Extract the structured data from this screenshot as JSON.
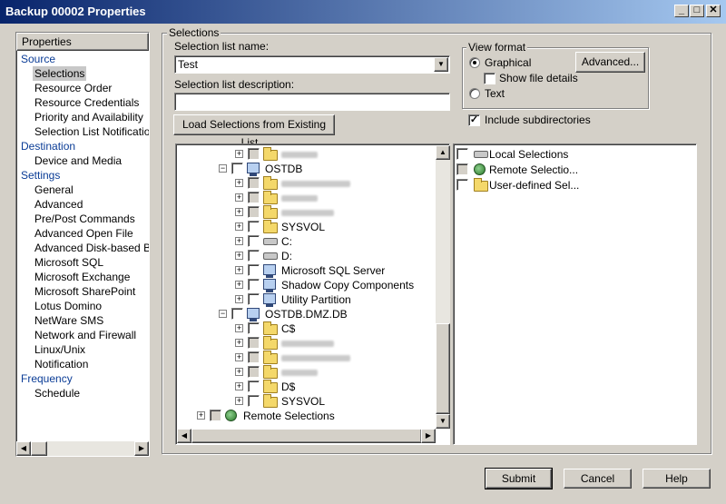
{
  "window": {
    "title": "Backup 00002 Properties",
    "controls": [
      "_",
      "□",
      "✕"
    ]
  },
  "nav": {
    "header": "Properties",
    "items": [
      {
        "label": "Source",
        "kind": "cat"
      },
      {
        "label": "Selections",
        "kind": "sel"
      },
      {
        "label": "Resource Order",
        "kind": "sub"
      },
      {
        "label": "Resource Credentials",
        "kind": "sub"
      },
      {
        "label": "Priority and Availability",
        "kind": "sub"
      },
      {
        "label": "Selection List Notification",
        "kind": "sub"
      },
      {
        "label": "Destination",
        "kind": "cat"
      },
      {
        "label": "Device and Media",
        "kind": "sub"
      },
      {
        "label": "Settings",
        "kind": "cat"
      },
      {
        "label": "General",
        "kind": "sub"
      },
      {
        "label": "Advanced",
        "kind": "sub"
      },
      {
        "label": "Pre/Post Commands",
        "kind": "sub"
      },
      {
        "label": "Advanced Open File",
        "kind": "sub"
      },
      {
        "label": "Advanced Disk-based Bac",
        "kind": "sub"
      },
      {
        "label": "Microsoft SQL",
        "kind": "sub"
      },
      {
        "label": "Microsoft Exchange",
        "kind": "sub"
      },
      {
        "label": "Microsoft SharePoint",
        "kind": "sub"
      },
      {
        "label": "Lotus Domino",
        "kind": "sub"
      },
      {
        "label": "NetWare SMS",
        "kind": "sub"
      },
      {
        "label": "Network and Firewall",
        "kind": "sub"
      },
      {
        "label": "Linux/Unix",
        "kind": "sub"
      },
      {
        "label": "Notification",
        "kind": "sub"
      },
      {
        "label": "Frequency",
        "kind": "cat"
      },
      {
        "label": "Schedule",
        "kind": "sub"
      }
    ]
  },
  "selections": {
    "group_label": "Selections",
    "list_name_label": "Selection list name:",
    "list_name_value": "Test",
    "description_label": "Selection list description:",
    "description_value": "",
    "load_button": "Load Selections from Existing List..."
  },
  "view_format": {
    "group_label": "View format",
    "graphical": "Graphical",
    "graphical_selected": true,
    "show_file_details": "Show file details",
    "text": "Text",
    "advanced_button": "Advanced...",
    "include_subdirectories": "Include subdirectories",
    "include_subdirectories_checked": true
  },
  "tree": [
    {
      "label": "",
      "icon": "folder-icon",
      "blurred": true,
      "depth": 2,
      "expander": "+"
    },
    {
      "label": "OSTDB",
      "icon": "computer-icon",
      "depth": 1,
      "expander": "-"
    },
    {
      "label": "",
      "icon": "folder-icon",
      "blurred": true,
      "depth": 2,
      "expander": "+"
    },
    {
      "label": "",
      "icon": "folder-icon",
      "blurred": true,
      "depth": 2,
      "expander": "+"
    },
    {
      "label": "",
      "icon": "folder-icon",
      "blurred": true,
      "depth": 2,
      "expander": "+"
    },
    {
      "label": "SYSVOL",
      "icon": "folder-icon",
      "depth": 2,
      "expander": "+"
    },
    {
      "label": "C:",
      "icon": "drive-icon",
      "depth": 2,
      "expander": "+"
    },
    {
      "label": "D:",
      "icon": "drive-icon",
      "depth": 2,
      "expander": "+"
    },
    {
      "label": "Microsoft SQL Server",
      "icon": "database-icon",
      "depth": 2,
      "expander": "+"
    },
    {
      "label": "Shadow Copy Components",
      "icon": "shadow-copy-icon",
      "depth": 2,
      "expander": "+"
    },
    {
      "label": "Utility Partition",
      "icon": "utility-partition-icon",
      "depth": 2,
      "expander": "+"
    },
    {
      "label": "OSTDB.DMZ.DB",
      "icon": "computer-icon",
      "depth": 1,
      "expander": "-"
    },
    {
      "label": "C$",
      "icon": "folder-icon",
      "depth": 2,
      "expander": "+"
    },
    {
      "label": "",
      "icon": "folder-icon",
      "blurred": true,
      "depth": 2,
      "expander": "+"
    },
    {
      "label": "",
      "icon": "folder-icon",
      "blurred": true,
      "depth": 2,
      "expander": "+"
    },
    {
      "label": "",
      "icon": "folder-icon",
      "blurred": true,
      "depth": 2,
      "expander": "+"
    },
    {
      "label": "D$",
      "icon": "folder-icon",
      "depth": 2,
      "expander": "+"
    },
    {
      "label": "SYSVOL",
      "icon": "folder-icon",
      "depth": 2,
      "expander": "+"
    },
    {
      "label": "Remote Selections",
      "icon": "globe-icon",
      "depth": 0,
      "expander": "+"
    }
  ],
  "right_list": [
    {
      "label": "Local Selections",
      "icon": "drive-icon"
    },
    {
      "label": "Remote Selectio...",
      "icon": "globe-icon"
    },
    {
      "label": "User-defined Sel...",
      "icon": "folder-icon"
    }
  ],
  "buttons": {
    "submit": "Submit",
    "cancel": "Cancel",
    "help": "Help"
  }
}
